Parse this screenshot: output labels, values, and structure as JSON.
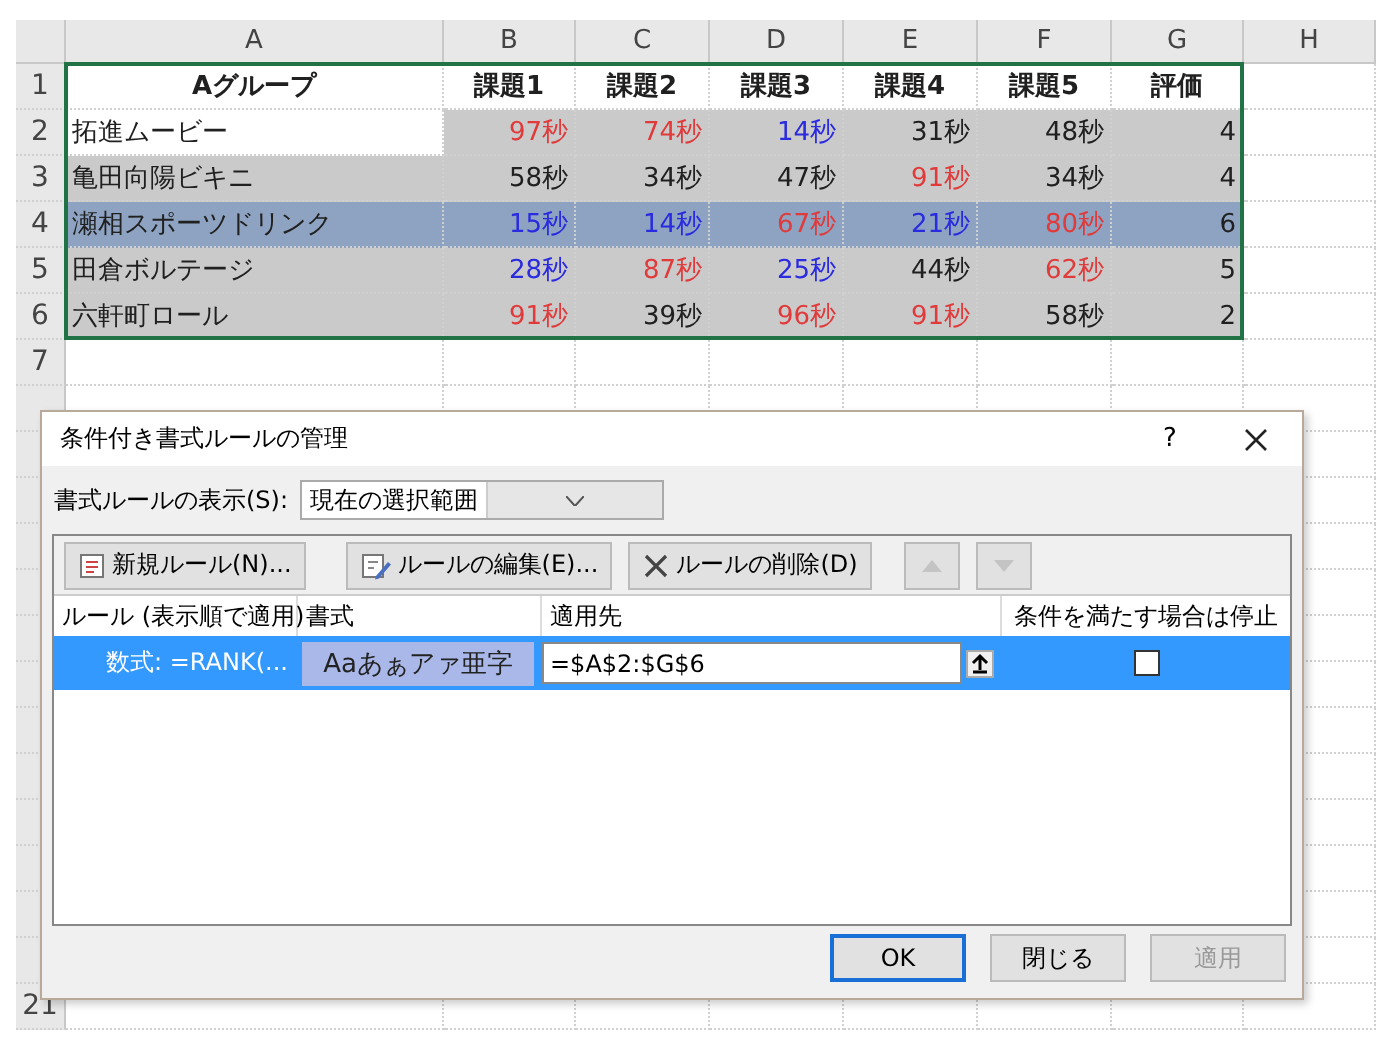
{
  "sheet": {
    "columns": [
      "A",
      "B",
      "C",
      "D",
      "E",
      "F",
      "G",
      "H"
    ],
    "rows": [
      {
        "header": "1",
        "kind": "title",
        "cells": [
          {
            "text": "Aグループ"
          },
          {
            "text": "課題1"
          },
          {
            "text": "課題2"
          },
          {
            "text": "課題3"
          },
          {
            "text": "課題4"
          },
          {
            "text": "課題5"
          },
          {
            "text": "評価"
          }
        ]
      },
      {
        "header": "2",
        "kind": "data",
        "highlighted": false,
        "cells": [
          {
            "text": "拓進ムービー",
            "active": true
          },
          {
            "text": "97秒",
            "color": "#e03a3a",
            "active": false
          },
          {
            "text": "74秒",
            "color": "#e03a3a",
            "active": false
          },
          {
            "text": "14秒",
            "color": "#2a2ae0",
            "active": false
          },
          {
            "text": "31秒",
            "color": "#202020",
            "active": false
          },
          {
            "text": "48秒",
            "color": "#202020",
            "active": false
          },
          {
            "text": "4",
            "active": false
          }
        ]
      },
      {
        "header": "3",
        "kind": "data",
        "highlighted": false,
        "cells": [
          {
            "text": "亀田向陽ビキニ",
            "active": false
          },
          {
            "text": "58秒",
            "color": "#202020",
            "active": false
          },
          {
            "text": "34秒",
            "color": "#202020",
            "active": false
          },
          {
            "text": "47秒",
            "color": "#202020",
            "active": false
          },
          {
            "text": "91秒",
            "color": "#e03a3a",
            "active": false
          },
          {
            "text": "34秒",
            "color": "#202020",
            "active": false
          },
          {
            "text": "4",
            "active": false
          }
        ]
      },
      {
        "header": "4",
        "kind": "data",
        "highlighted": true,
        "cells": [
          {
            "text": "瀬相スポーツドリンク",
            "active": false
          },
          {
            "text": "15秒",
            "color": "#2a2ae0",
            "active": false
          },
          {
            "text": "14秒",
            "color": "#2a2ae0",
            "active": false
          },
          {
            "text": "67秒",
            "color": "#e03a3a",
            "active": false
          },
          {
            "text": "21秒",
            "color": "#2a2ae0",
            "active": false
          },
          {
            "text": "80秒",
            "color": "#e03a3a",
            "active": false
          },
          {
            "text": "6",
            "active": false
          }
        ]
      },
      {
        "header": "5",
        "kind": "data",
        "highlighted": false,
        "cells": [
          {
            "text": "田倉ボルテージ",
            "active": false
          },
          {
            "text": "28秒",
            "color": "#2a2ae0",
            "active": false
          },
          {
            "text": "87秒",
            "color": "#e03a3a",
            "active": false
          },
          {
            "text": "25秒",
            "color": "#2a2ae0",
            "active": false
          },
          {
            "text": "44秒",
            "color": "#202020",
            "active": false
          },
          {
            "text": "62秒",
            "color": "#e03a3a",
            "active": false
          },
          {
            "text": "5",
            "active": false
          }
        ]
      },
      {
        "header": "6",
        "kind": "data",
        "highlighted": false,
        "cells": [
          {
            "text": "六軒町ロール",
            "active": false
          },
          {
            "text": "91秒",
            "color": "#e03a3a",
            "active": false
          },
          {
            "text": "39秒",
            "color": "#202020",
            "active": false
          },
          {
            "text": "96秒",
            "color": "#e03a3a",
            "active": false
          },
          {
            "text": "91秒",
            "color": "#e03a3a",
            "active": false
          },
          {
            "text": "58秒",
            "color": "#202020",
            "active": false
          },
          {
            "text": "2",
            "active": false
          }
        ]
      },
      {
        "header": "7",
        "kind": "empty"
      },
      {
        "header": "21",
        "kind": "empty"
      }
    ]
  },
  "dialog": {
    "title": "条件付き書式ルールの管理",
    "help": "?",
    "show_rules": {
      "label": "書式ルールの表示(S):",
      "value": "現在の選択範囲"
    },
    "toolbar": [
      {
        "kind": "new",
        "label": "新規ルール(N)...",
        "disabled": false
      },
      {
        "kind": "edit",
        "label": "ルールの編集(E)...",
        "disabled": false
      },
      {
        "kind": "delete",
        "label": "ルールの削除(D)",
        "disabled": false
      },
      {
        "kind": "up",
        "disabled": true
      },
      {
        "kind": "down",
        "disabled": true
      }
    ],
    "rules_table": {
      "columns": [
        "ルール (表示順で適用)",
        "書式",
        "適用先",
        "条件を満たす場合は停止"
      ],
      "rows": [
        {
          "rule": "数式: =RANK(...",
          "preview": "Aaあぁアァ亜字",
          "applies_to": "=$A$2:$G$6",
          "stop_if_true": false,
          "selected": true
        }
      ]
    },
    "buttons": [
      {
        "label": "OK",
        "default": true,
        "disabled": false
      },
      {
        "label": "閉じる",
        "default": false,
        "disabled": false
      },
      {
        "label": "適用",
        "default": false,
        "disabled": true
      }
    ]
  }
}
